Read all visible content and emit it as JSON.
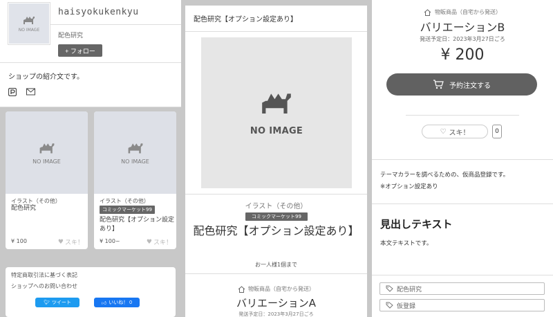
{
  "shop": {
    "name": "haisyokukenkyu",
    "sub": "配色研究",
    "follow_label": "+ フォロー",
    "intro": "ショップの紹介文です。",
    "noimage_label": "NO IMAGE"
  },
  "cards": [
    {
      "category": "イラスト（その他）",
      "title": "配色研究",
      "badge": "",
      "price": "¥ 100",
      "like": "スキ！"
    },
    {
      "category": "イラスト（その他）",
      "title": "配色研究【オプション設定あり】",
      "badge": "コミックマーケット99",
      "price": "¥ 100~",
      "like": "スキ！"
    }
  ],
  "legal": {
    "law": "特定商取引法に基づく表記",
    "contact": "ショップへのお問い合わせ",
    "tweet": "ツイート",
    "fb": "いいね！ 0"
  },
  "product": {
    "header_title": "配色研究【オプション設定あり】",
    "noimage_label": "NO IMAGE",
    "category": "イラスト（その他）",
    "badge": "コミックマーケット99",
    "title": "配色研究【オプション設定あり】",
    "limit": "お一人様1個まで"
  },
  "variations": [
    {
      "kind": "物販商品（自宅から発送）",
      "name": "バリエーションA",
      "ship": "発送予定日：2023年3月27日ごろ"
    },
    {
      "kind": "物販商品（自宅から発送）",
      "name": "バリエーションB",
      "ship": "発送予定日：2023年3月27日ごろ",
      "price": "¥ 200",
      "order_label": "予約注文する",
      "like_label": "スキ！",
      "like_count": "0"
    }
  ],
  "description": {
    "line1": "テーマカラーを調べるための、仮商品登録です。",
    "line2": "※オプション設定あり",
    "heading": "見出しテキスト",
    "body": "本文テキストです。"
  },
  "tags": [
    "配色研究",
    "仮登録"
  ],
  "colors": {
    "dark_gray": "#616161",
    "tweet_blue": "#1d9bf0",
    "fb_blue": "#1877f2"
  }
}
